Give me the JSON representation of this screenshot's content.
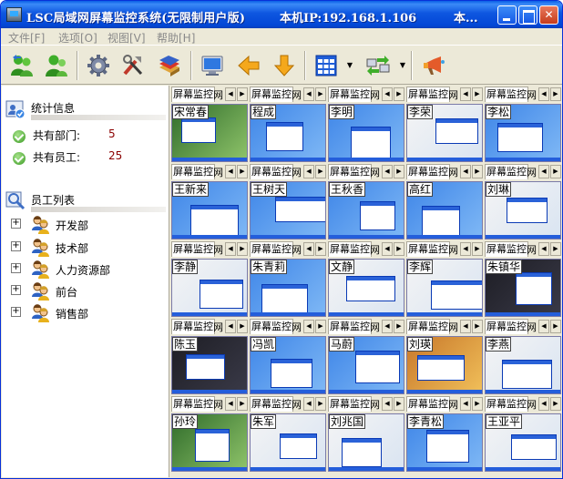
{
  "window": {
    "title": "LSC局域网屏幕监控系统(无限制用户版)",
    "ip_text": "本机IP:192.168.1.106",
    "more_text": "本..."
  },
  "menu": [
    {
      "label": "文件[F]"
    },
    {
      "label": "选项[O]"
    },
    {
      "label": "视图[V]"
    },
    {
      "label": "帮助[H]"
    }
  ],
  "toolbar_icons": [
    "users-online-icon",
    "user-icon",
    "gear-icon",
    "tools-icon",
    "books-icon",
    "monitor-icon",
    "arrow-left-icon",
    "arrow-down-icon",
    "grid-view-icon",
    "transfer-icon",
    "megaphone-icon"
  ],
  "stats": {
    "title": "统计信息",
    "departments_label": "共有部门:",
    "departments_value": "5",
    "employees_label": "共有员工:",
    "employees_value": "25"
  },
  "employees": {
    "title": "员工列表",
    "departments": [
      {
        "label": "开发部",
        "expander": "+"
      },
      {
        "label": "技术部",
        "expander": "+"
      },
      {
        "label": "人力资源部",
        "expander": "+"
      },
      {
        "label": "前台",
        "expander": "+"
      },
      {
        "label": "销售部",
        "expander": "+"
      }
    ]
  },
  "tab_labels": {
    "screen": "屏幕监控",
    "net": "网",
    "arrow_left": "◀",
    "arrow_right": "▶"
  },
  "screens": [
    {
      "name": "宋常春",
      "theme": "nature"
    },
    {
      "name": "程成",
      "theme": "xp"
    },
    {
      "name": "李明",
      "theme": "xp"
    },
    {
      "name": "李荣",
      "theme": "web"
    },
    {
      "name": "李松",
      "theme": "xp"
    },
    {
      "name": "王新来",
      "theme": "xp"
    },
    {
      "name": "王树天",
      "theme": "xp"
    },
    {
      "name": "王秋香",
      "theme": "xp"
    },
    {
      "name": "高红",
      "theme": "xp"
    },
    {
      "name": "刘琳",
      "theme": "web"
    },
    {
      "name": "李静",
      "theme": "web"
    },
    {
      "name": "朱青莉",
      "theme": "xp"
    },
    {
      "name": "文静",
      "theme": "web"
    },
    {
      "name": "李辉",
      "theme": "web"
    },
    {
      "name": "朱镇华",
      "theme": "dark"
    },
    {
      "name": "陈玉",
      "theme": "dark"
    },
    {
      "name": "冯凯",
      "theme": "xp"
    },
    {
      "name": "马蔚",
      "theme": "xp"
    },
    {
      "name": "刘瑛",
      "theme": "game"
    },
    {
      "name": "李燕",
      "theme": "web"
    },
    {
      "name": "孙玲",
      "theme": "nature"
    },
    {
      "name": "朱军",
      "theme": "web"
    },
    {
      "name": "刘兆国",
      "theme": "web"
    },
    {
      "name": "李青松",
      "theme": "xp"
    },
    {
      "name": "王亚平",
      "theme": "web"
    }
  ],
  "colors": {
    "title_bar": "#0A5FE6",
    "face": "#ECE9D8",
    "stat_value": "#8B0000"
  }
}
